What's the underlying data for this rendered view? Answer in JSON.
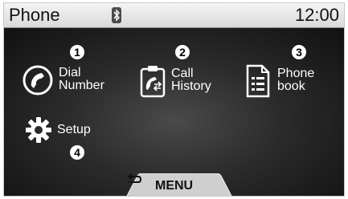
{
  "header": {
    "title": "Phone",
    "clock": "12:00",
    "bluetooth_icon": "bluetooth-icon"
  },
  "menu": [
    {
      "number": "1",
      "label": "Dial\nNumber",
      "icon": "handset-icon"
    },
    {
      "number": "2",
      "label": "Call\nHistory",
      "icon": "call-history-icon"
    },
    {
      "number": "3",
      "label": "Phone\nbook",
      "icon": "phonebook-icon"
    },
    {
      "number": "4",
      "label": "Setup",
      "icon": "gear-icon"
    }
  ],
  "bottom_tab": {
    "label": "MENU",
    "icon": "back-arrow-icon"
  }
}
